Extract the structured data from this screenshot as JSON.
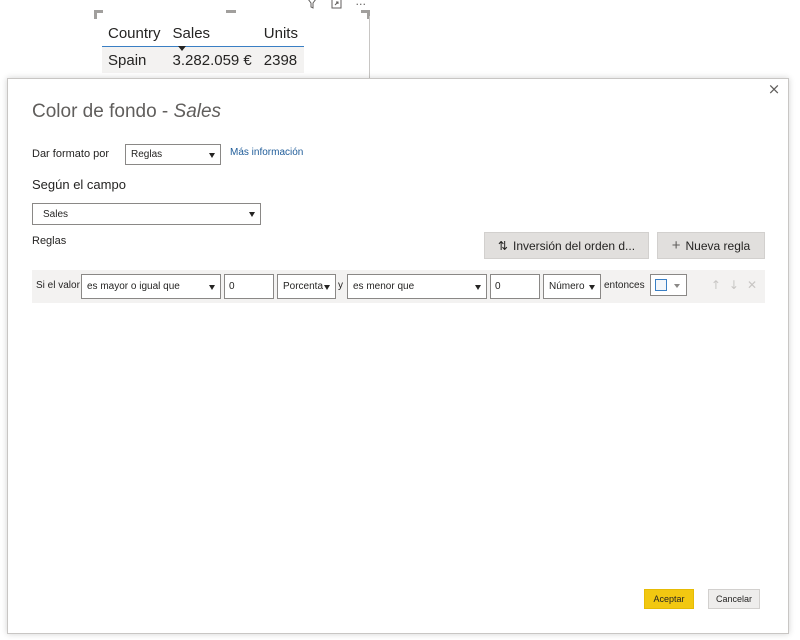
{
  "visual": {
    "tools": {
      "filter_icon": "filter-icon",
      "focus_icon": "focus-mode-icon",
      "more": "···"
    },
    "table": {
      "columns": [
        "Country",
        "Sales",
        "Units"
      ],
      "rows": [
        {
          "country": "Spain",
          "sales": "3.282.059 €",
          "units": "2398"
        }
      ]
    }
  },
  "dialog": {
    "close": "×",
    "title_prefix": "Color de fondo - ",
    "title_field": "Sales",
    "format_by_label": "Dar formato por",
    "format_by_value": "Reglas",
    "more_info_link": "Más información",
    "based_on_heading": "Según el campo",
    "based_on_value": "Sales",
    "rules_label": "Reglas",
    "reverse_button": "Inversión del orden d...",
    "new_rule_button": "Nueva regla",
    "rule": {
      "if_value_label": "Si el valor",
      "op1": "es mayor o igual que",
      "val1": "0",
      "type1": "Porcenta",
      "and_label": "y",
      "op2": "es menor que",
      "val2": "0",
      "type2": "Número",
      "then_label": "entonces",
      "swatch_color": "#f3f6fa"
    },
    "accept_button": "Aceptar",
    "cancel_button": "Cancelar"
  },
  "colors": {
    "accent_yellow": "#f2c811",
    "link_blue": "#1f5c99"
  }
}
